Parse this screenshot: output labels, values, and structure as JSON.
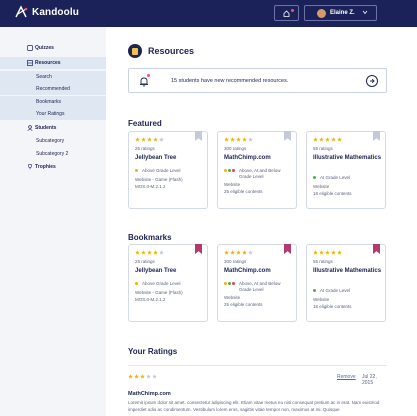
{
  "app": {
    "brand": "Kandoolu",
    "user_name": "Elaine Z."
  },
  "colors": {
    "topbar": "#1a2259",
    "sidebar_bg": "#f3f5f9",
    "sidebar_active": "#dfe7f2",
    "star_filled": "#f5b400",
    "star_empty": "#c5cad8",
    "bookmark_off": "#c5cad8",
    "bookmark_on": "#b23a72",
    "link": "#3c6fd6",
    "notification": "#ff4e6a"
  },
  "sidebar": {
    "items": [
      {
        "label": "Quizzes",
        "icon": "quiz-icon"
      },
      {
        "label": "Resources",
        "icon": "resources-icon"
      },
      {
        "label": "Search"
      },
      {
        "label": "Recommended"
      },
      {
        "label": "Bookmarks"
      },
      {
        "label": "Your Ratings"
      },
      {
        "label": "Students",
        "icon": "students-icon"
      },
      {
        "label": "Subcategory"
      },
      {
        "label": "Subcategory 2"
      },
      {
        "label": "Trophies",
        "icon": "trophy-icon"
      }
    ]
  },
  "main": {
    "title": "Resources",
    "alert": "15 students have new recommended resources.",
    "featured_title": "Featured",
    "bookmarks_title": "Bookmarks",
    "ratings_title": "Your Ratings",
    "featured": [
      {
        "stars": 4,
        "ratings": "25 ratings",
        "name": "Jellybean Tree",
        "grade": "Above Grade Level",
        "grade_dots": [
          "#f5b400"
        ],
        "meta1": "Website - Game (Flash)",
        "meta2": "MOS.0-M.2.1.2",
        "bookmarked": false
      },
      {
        "stars": 4,
        "ratings": "300 ratings",
        "name": "MathChimp.com",
        "grade": "Above, At and Below Grade Level",
        "grade_dots": [
          "#f5b400",
          "#4caf50",
          "#e0454f"
        ],
        "meta1": "Website",
        "meta2": "25 eligible contents",
        "bookmarked": false
      },
      {
        "stars": 5,
        "ratings": "55 ratings",
        "name": "Illustrative Mathematics",
        "grade": "At Grade Level",
        "grade_dots": [
          "#4caf50"
        ],
        "meta1": "Website",
        "meta2": "18 eligible contents",
        "bookmarked": false
      }
    ],
    "bookmarks": [
      {
        "stars": 4,
        "ratings": "25 ratings",
        "name": "Jellybean Tree",
        "grade": "Above Grade Level",
        "grade_dots": [
          "#f5b400"
        ],
        "meta1": "Website - Game (Flash)",
        "meta2": "MOS.0-M.2.1.2",
        "bookmarked": true
      },
      {
        "stars": 4,
        "ratings": "300 ratings",
        "name": "MathChimp.com",
        "grade": "Above, At and Below Grade Level",
        "grade_dots": [
          "#f5b400",
          "#4caf50",
          "#e0454f"
        ],
        "meta1": "Website",
        "meta2": "25 eligible contents",
        "bookmarked": true
      },
      {
        "stars": 5,
        "ratings": "55 ratings",
        "name": "Illustrative Mathematics",
        "grade": "At Grade Level",
        "grade_dots": [
          "#4caf50"
        ],
        "meta1": "Website",
        "meta2": "18 eligible contents",
        "bookmarked": true
      }
    ],
    "rating_entry": {
      "stars": 3,
      "remove_label": "Remove",
      "date": "Jul 22, 2015",
      "name": "MathChimp.com",
      "text": "Loremit ipsum dolor sit amet, consectetur adipiscing elit. Etiam vitae metus eu nisi consequat pretium ac in erat. Nam euismod imperdiet odio ac condimentum. Vestibulum lorem eros, sagittis vitae tempor non, maximus at mi. Quisque"
    }
  }
}
